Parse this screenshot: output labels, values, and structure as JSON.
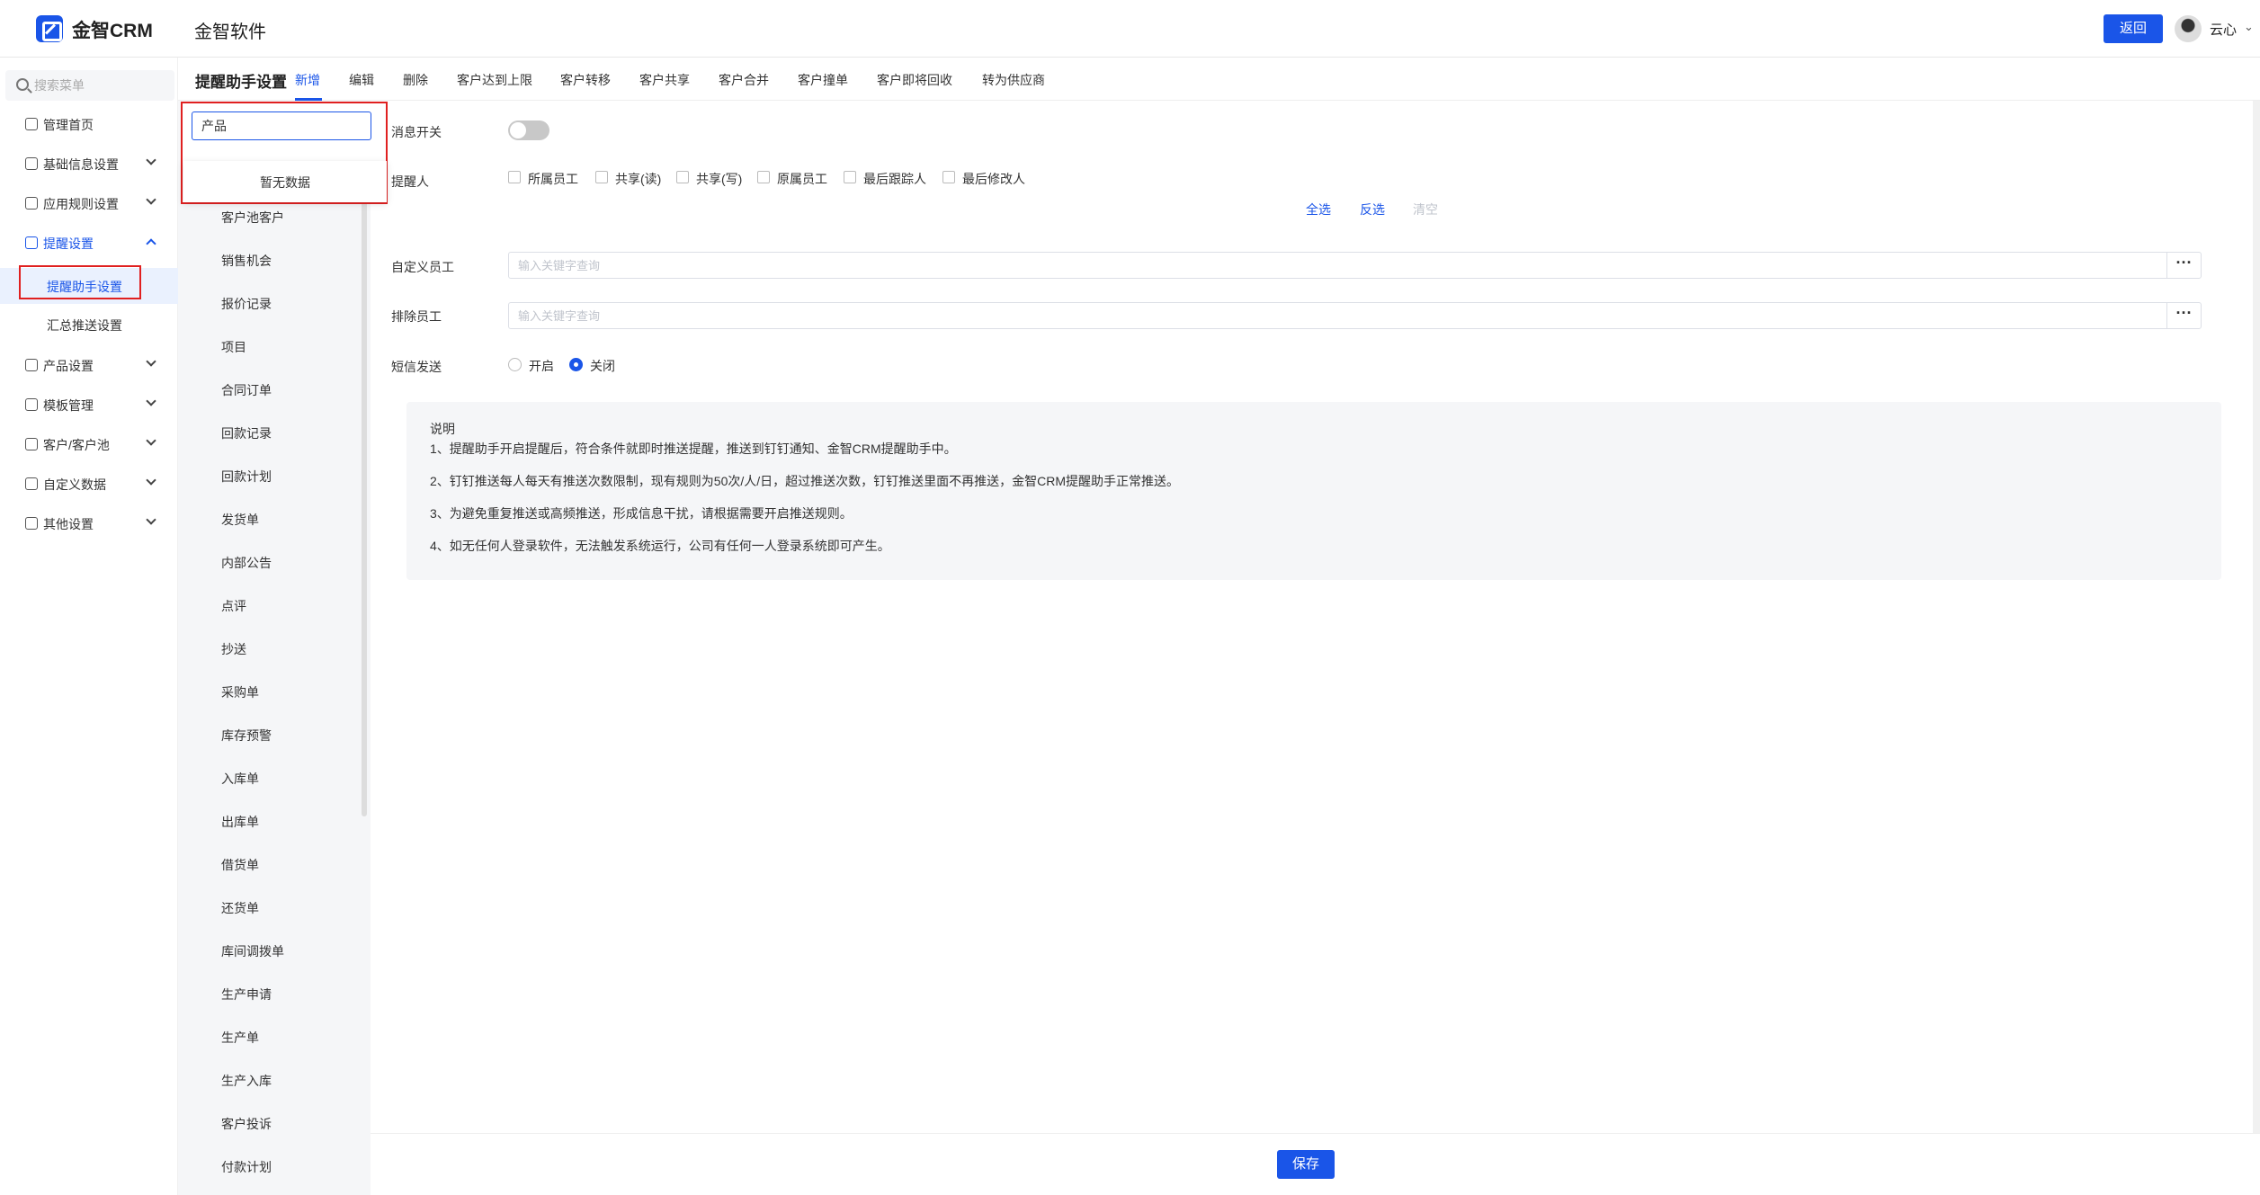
{
  "header": {
    "logo_text": "金智CRM",
    "app_title": "金智软件",
    "back_label": "返回",
    "username": "云心",
    "user_chevron": "⌄"
  },
  "sidebar": {
    "search_placeholder": "搜索菜单",
    "items": [
      {
        "label": "管理首页",
        "icon": "home-icon"
      },
      {
        "label": "基础信息设置",
        "icon": "cube-icon"
      },
      {
        "label": "应用规则设置",
        "icon": "document-icon"
      },
      {
        "label": "提醒设置",
        "icon": "bell-icon"
      },
      {
        "label": "产品设置",
        "icon": "box-icon"
      },
      {
        "label": "模板管理",
        "icon": "template-icon"
      },
      {
        "label": "客户/客户池",
        "icon": "users-icon"
      },
      {
        "label": "自定义数据",
        "icon": "custom-data-icon"
      },
      {
        "label": "其他设置",
        "icon": "grid-icon"
      }
    ],
    "sub_items": [
      {
        "label": "提醒助手设置"
      },
      {
        "label": "汇总推送设置"
      }
    ]
  },
  "tabs": {
    "heading": "提醒助手设置",
    "items": [
      "新增",
      "编辑",
      "删除",
      "客户达到上限",
      "客户转移",
      "客户共享",
      "客户合并",
      "客户撞单",
      "客户即将回收",
      "转为供应商"
    ]
  },
  "modules": {
    "search_value": "产品",
    "no_data": "暂无数据",
    "items": [
      "客户池客户",
      "销售机会",
      "报价记录",
      "项目",
      "合同订单",
      "回款记录",
      "回款计划",
      "发货单",
      "内部公告",
      "点评",
      "抄送",
      "采购单",
      "库存预警",
      "入库单",
      "出库单",
      "借货单",
      "还货单",
      "库间调拨单",
      "生产申请",
      "生产单",
      "生产入库",
      "客户投诉",
      "付款计划"
    ]
  },
  "form": {
    "switch_label": "消息开关",
    "switch_on": false,
    "reminder_label": "提醒人",
    "reminder_options": [
      "所属员工",
      "共享(读)",
      "共享(写)",
      "原属员工",
      "最后跟踪人",
      "最后修改人"
    ],
    "select_all": "全选",
    "invert": "反选",
    "clear": "清空",
    "custom_label": "自定义员工",
    "custom_placeholder": "输入关键字查询",
    "exclude_label": "排除员工",
    "exclude_placeholder": "输入关键字查询",
    "more_label": "···",
    "sms_label": "短信发送",
    "sms_on": "开启",
    "sms_off": "关闭",
    "notes_title": "说明",
    "notes": [
      "1、提醒助手开启提醒后，符合条件就即时推送提醒，推送到钉钉通知、金智CRM提醒助手中。",
      "2、钉钉推送每人每天有推送次数限制，现有规则为50次/人/日，超过推送次数，钉钉推送里面不再推送，金智CRM提醒助手正常推送。",
      "3、为避免重复推送或高频推送，形成信息干扰，请根据需要开启推送规则。",
      "4、如无任何人登录软件，无法触发系统运行，公司有任何一人登录系统即可产生。"
    ]
  },
  "footer": {
    "save_label": "保存"
  },
  "colors": {
    "accent": "#1a55e8",
    "highlight": "#e02020"
  }
}
